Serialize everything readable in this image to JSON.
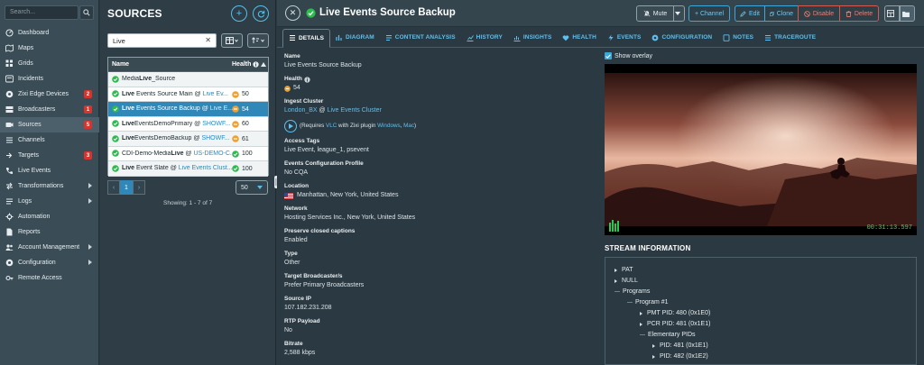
{
  "nav": {
    "search_placeholder": "Search...",
    "items": [
      {
        "label": "Dashboard",
        "icon": "dashboard-icon"
      },
      {
        "label": "Maps",
        "icon": "map-icon"
      },
      {
        "label": "Grids",
        "icon": "grid-icon"
      },
      {
        "label": "Incidents",
        "icon": "incident-icon"
      },
      {
        "label": "Zixi Edge Devices",
        "icon": "edge-device-icon",
        "badge": "2"
      },
      {
        "label": "Broadcasters",
        "icon": "broadcaster-icon",
        "badge": "1"
      },
      {
        "label": "Sources",
        "icon": "source-icon",
        "badge": "5",
        "active": true
      },
      {
        "label": "Channels",
        "icon": "channel-icon"
      },
      {
        "label": "Targets",
        "icon": "target-icon",
        "badge": "3"
      },
      {
        "label": "Live Events",
        "icon": "live-events-icon"
      },
      {
        "label": "Transformations",
        "icon": "transform-icon",
        "caret": true
      },
      {
        "label": "Logs",
        "icon": "logs-icon",
        "caret": true
      },
      {
        "label": "Automation",
        "icon": "automation-icon"
      },
      {
        "label": "Reports",
        "icon": "reports-icon"
      },
      {
        "label": "Account Management",
        "icon": "account-icon",
        "caret": true
      },
      {
        "label": "Configuration",
        "icon": "configuration-icon",
        "caret": true
      },
      {
        "label": "Remote Access",
        "icon": "remote-access-icon"
      }
    ]
  },
  "sources": {
    "title": "SOURCES",
    "search_value": "Live",
    "columns": {
      "name": "Name",
      "health": "Health"
    },
    "rows": [
      {
        "pre": "Media",
        "bold": "Live",
        "post": "_Source",
        "link": "",
        "health": "",
        "status": "green"
      },
      {
        "pre": "",
        "bold": "Live",
        "post": " Events Source Main @ ",
        "link": "Live Ev...",
        "health": "50",
        "status": "green",
        "hstatus": "orange"
      },
      {
        "pre": "",
        "bold": "Live",
        "post": " Events Source Backup @ ",
        "link": "Live E...",
        "health": "54",
        "status": "green",
        "hstatus": "orange",
        "selected": true
      },
      {
        "pre": "",
        "bold": "Live",
        "post": "EventsDemoPrimary @ ",
        "link": "SHOWF...",
        "health": "60",
        "status": "green",
        "hstatus": "orange"
      },
      {
        "pre": "",
        "bold": "Live",
        "post": "EventsDemoBackup @ ",
        "link": "SHOWF...",
        "health": "61",
        "status": "green",
        "hstatus": "orange"
      },
      {
        "pre": "CDI-Demo-Media",
        "bold": "Live",
        "post": " @ ",
        "link": "US-DEMO-C...",
        "health": "100",
        "status": "green",
        "hstatus": "green"
      },
      {
        "pre": "",
        "bold": "Live",
        "post": " Event Slate @ ",
        "link": "Live Events Clust...",
        "health": "100",
        "status": "green",
        "hstatus": "green"
      }
    ],
    "pager": {
      "prev": "‹",
      "page": "1",
      "next": "›",
      "page_size": "50"
    },
    "showing": "Showing: 1 - 7 of 7"
  },
  "detail": {
    "title": "Live Events Source Backup",
    "toolbar": {
      "mute": "Mute",
      "channel": "+ Channel",
      "edit": "Edit",
      "clone": "Clone",
      "disable": "Disable",
      "delete": "Delete"
    },
    "tabs": [
      "DETAILS",
      "DIAGRAM",
      "CONTENT ANALYSIS",
      "HISTORY",
      "INSIGHTS",
      "HEALTH",
      "EVENTS",
      "CONFIGURATION",
      "NOTES",
      "TRACEROUTE"
    ],
    "fields": {
      "name_label": "Name",
      "name_value": "Live Events Source Backup",
      "health_label": "Health",
      "health_value": "54",
      "ingest_label": "Ingest Cluster",
      "ingest_link1": "London_BX",
      "ingest_at": " @ ",
      "ingest_link2": "Live Events Cluster",
      "play_pre": "(Requires ",
      "play_vlc": "VLC",
      "play_mid": " with Zixi plugin ",
      "play_win": "Windows",
      "play_comma": ", ",
      "play_mac": "Mac",
      "play_post": ")",
      "tags_label": "Access Tags",
      "tags_value": "Live Event, league_1, psevent",
      "profile_label": "Events Configuration Profile",
      "profile_value": "No CQA",
      "location_label": "Location",
      "location_value": "Manhattan, New York, United States",
      "network_label": "Network",
      "network_value": "Hosting Services Inc., New York, United States",
      "cc_label": "Preserve closed captions",
      "cc_value": "Enabled",
      "type_label": "Type",
      "type_value": "Other",
      "target_label": "Target Broadcaster/s",
      "target_value": "Prefer Primary Broadcasters",
      "ip_label": "Source IP",
      "ip_value": "107.182.231.208",
      "rtp_label": "RTP Payload",
      "rtp_value": "No",
      "bitrate_label": "Bitrate",
      "bitrate_value": "2,588 kbps"
    },
    "overlay_label": "Show overlay",
    "video_time": "00:31:13.597",
    "stream_title": "STREAM INFORMATION",
    "stream_tree": {
      "pat": "PAT",
      "null": "NULL",
      "programs": "Programs",
      "program1": "Program #1",
      "pmt": "PMT PID: 480 (0x1E0)",
      "pcr": "PCR PID: 481 (0x1E1)",
      "elementary": "Elementary PIDs",
      "pid1": "PID: 481 (0x1E1)",
      "pid2": "PID: 482 (0x1E2)"
    }
  },
  "colors": {
    "accent": "#3fa6d9",
    "ok": "#2dbb4e",
    "warn": "#f0a030",
    "danger": "#d8342e",
    "selected_row": "#2f88b8"
  }
}
